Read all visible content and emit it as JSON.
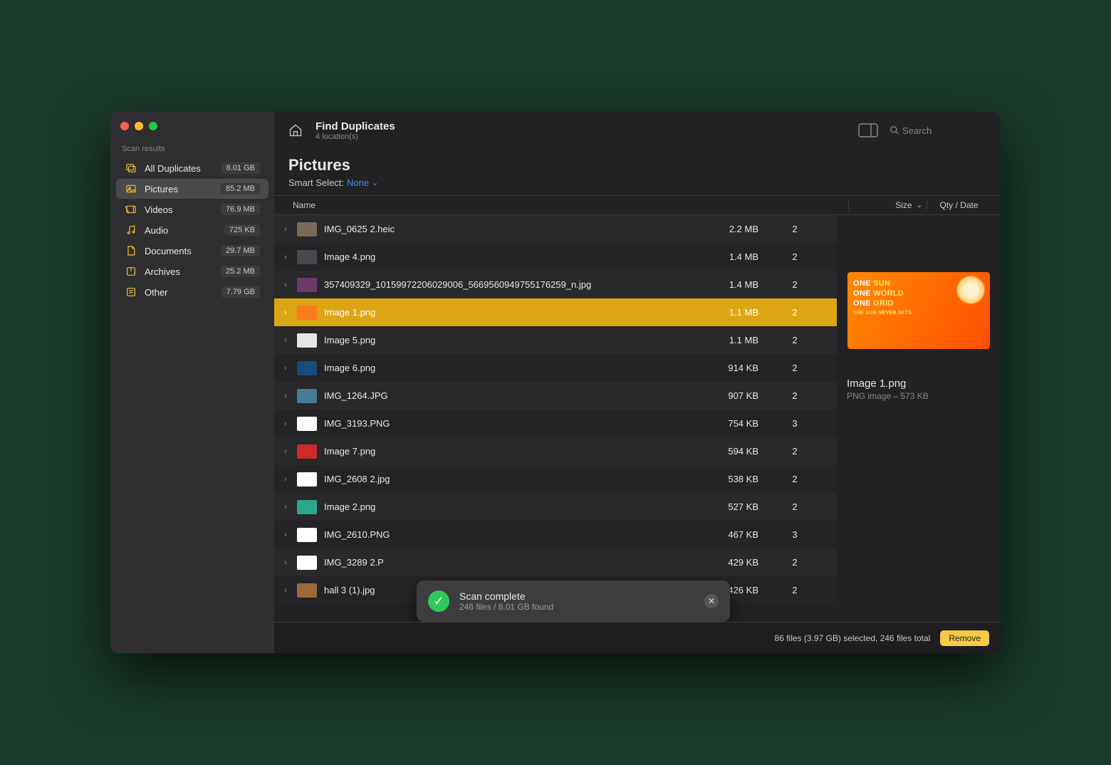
{
  "header": {
    "title": "Find Duplicates",
    "subtitle": "4 location(s)",
    "search_placeholder": "Search"
  },
  "sidebar": {
    "section_label": "Scan results",
    "items": [
      {
        "icon": "stack",
        "label": "All Duplicates",
        "badge": "8.01 GB",
        "color": "#f5c13a"
      },
      {
        "icon": "image",
        "label": "Pictures",
        "badge": "85.2 MB",
        "color": "#f5c13a",
        "selected": true
      },
      {
        "icon": "video",
        "label": "Videos",
        "badge": "76.9 MB",
        "color": "#f5c13a"
      },
      {
        "icon": "music",
        "label": "Audio",
        "badge": "725 KB",
        "color": "#f5c13a"
      },
      {
        "icon": "document",
        "label": "Documents",
        "badge": "29.7 MB",
        "color": "#f5c13a"
      },
      {
        "icon": "archive",
        "label": "Archives",
        "badge": "25.2 MB",
        "color": "#f5c13a"
      },
      {
        "icon": "other",
        "label": "Other",
        "badge": "7.79 GB",
        "color": "#f5c13a"
      }
    ]
  },
  "listing": {
    "heading": "Pictures",
    "smart_label": "Smart Select:",
    "smart_value": "None",
    "columns": {
      "name": "Name",
      "size": "Size",
      "qty": "Qty / Date"
    },
    "rows": [
      {
        "name": "IMG_0625 2.heic",
        "size": "2.2 MB",
        "qty": "2",
        "thumb": "#7a6a5a"
      },
      {
        "name": "Image 4.png",
        "size": "1.4 MB",
        "qty": "2",
        "thumb": "#4a4a4e"
      },
      {
        "name": "357409329_10159972206029006_5669560949755176259_n.jpg",
        "size": "1.4 MB",
        "qty": "2",
        "thumb": "#6b3a6a"
      },
      {
        "name": "Image 1.png",
        "size": "1.1 MB",
        "qty": "2",
        "thumb": "#ff7a1a",
        "selected": true
      },
      {
        "name": "Image 5.png",
        "size": "1.1 MB",
        "qty": "2",
        "thumb": "#e6e6e6"
      },
      {
        "name": "Image 6.png",
        "size": "914 KB",
        "qty": "2",
        "thumb": "#1a4a7a"
      },
      {
        "name": "IMG_1264.JPG",
        "size": "907 KB",
        "qty": "2",
        "thumb": "#4a7a9a"
      },
      {
        "name": "IMG_3193.PNG",
        "size": "754 KB",
        "qty": "3",
        "thumb": "#ffffff"
      },
      {
        "name": "Image 7.png",
        "size": "594 KB",
        "qty": "2",
        "thumb": "#d02a2a"
      },
      {
        "name": "IMG_2608 2.jpg",
        "size": "538 KB",
        "qty": "2",
        "thumb": "#ffffff"
      },
      {
        "name": "Image 2.png",
        "size": "527 KB",
        "qty": "2",
        "thumb": "#2aa88a"
      },
      {
        "name": "IMG_2610.PNG",
        "size": "467 KB",
        "qty": "3",
        "thumb": "#ffffff"
      },
      {
        "name": "IMG_3289 2.P",
        "size": "429 KB",
        "qty": "2",
        "thumb": "#ffffff"
      },
      {
        "name": "hall 3 (1).jpg",
        "size": "426 KB",
        "qty": "2",
        "thumb": "#9a6a3a"
      }
    ]
  },
  "preview": {
    "name": "Image 1.png",
    "meta": "PNG image – 573 KB",
    "thumb_lines": [
      "ONE SUN",
      "ONE WORLD",
      "ONE GRID",
      "THE SUN NEVER SETS"
    ]
  },
  "footer": {
    "status": "86 files (3.97 GB) selected, 246 files total",
    "remove_label": "Remove"
  },
  "toast": {
    "title": "Scan complete",
    "subtitle": "246 files / 8.01 GB found"
  }
}
